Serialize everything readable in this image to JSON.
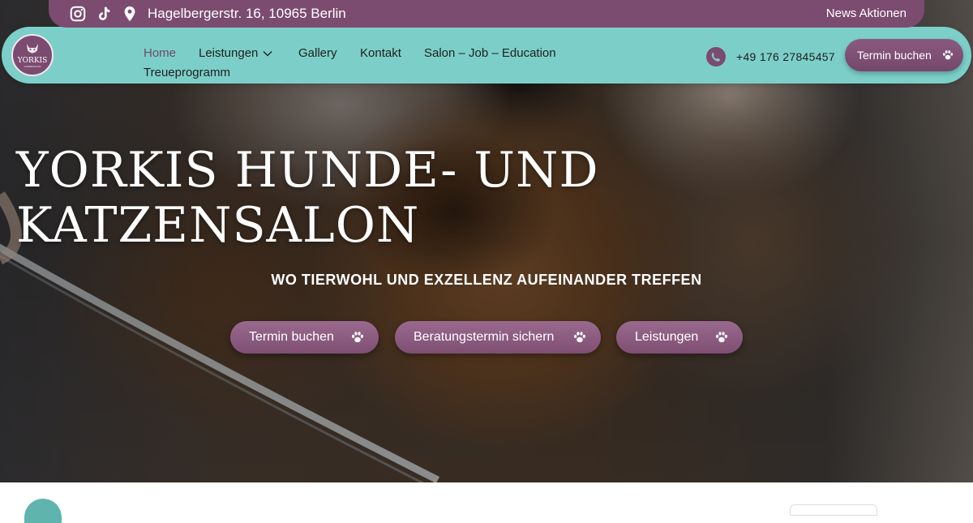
{
  "topbar": {
    "icons": [
      "instagram-icon",
      "tiktok-icon",
      "location-pin-icon"
    ],
    "address": "Hagelbergerstr. 16, 10965 Berlin",
    "news_link": "News Aktionen"
  },
  "nav": {
    "logo_text": "YORKIS",
    "logo_sub": "HUNDESALON",
    "items": [
      {
        "label": "Home",
        "active": true
      },
      {
        "label": "Leistungen",
        "has_dropdown": true
      },
      {
        "label": "Gallery"
      },
      {
        "label": "Kontakt"
      },
      {
        "label": "Salon – Job – Education"
      },
      {
        "label": "Treueprogramm"
      }
    ],
    "phone": "+49 176 27845457",
    "cta_label": "Termin buchen"
  },
  "hero": {
    "title": "YORKIS HUNDE- UND KATZENSALON",
    "subtitle": "WO TIERWOHL UND EXZELLENZ AUFEINANDER TREFFEN",
    "buttons": [
      {
        "label": "Termin buchen",
        "icon": "paw-icon"
      },
      {
        "label": "Beratungstermin sichern",
        "icon": "paw-icon"
      },
      {
        "label": "Leistungen",
        "icon": "paw-icon"
      }
    ]
  },
  "colors": {
    "brand_purple": "#7b4b70",
    "nav_teal": "#7ccfc8",
    "active_link": "#6e4a66"
  }
}
